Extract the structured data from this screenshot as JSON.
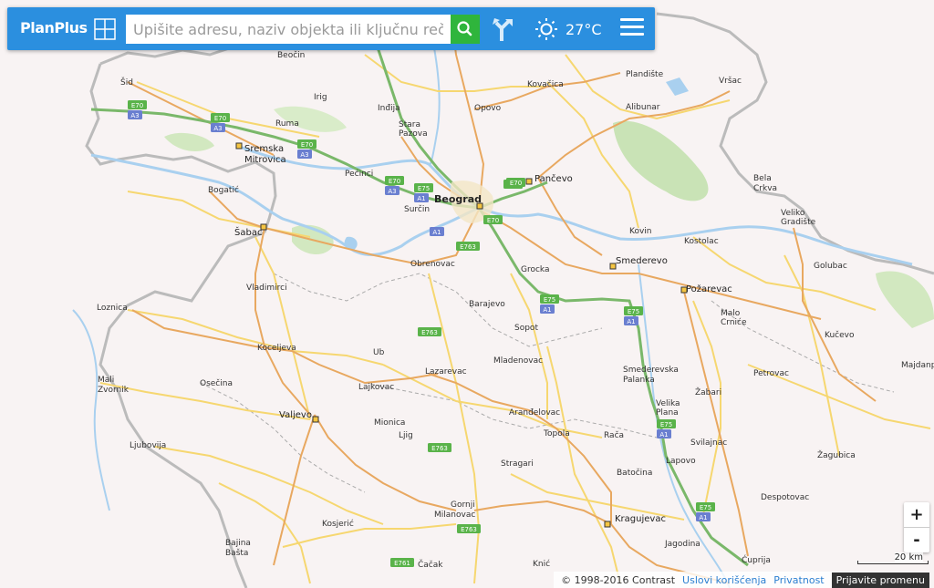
{
  "toolbar": {
    "logo": "PlanPlus",
    "search_placeholder": "Upišite adresu, naziv objekta ili ključnu reč",
    "temperature": "27°C",
    "icons": [
      "grid-icon",
      "search-icon",
      "route-icon",
      "sun-icon",
      "menu-icon"
    ]
  },
  "map": {
    "cities": [
      {
        "name": "Beočin",
        "style": "small"
      },
      {
        "name": "Šid",
        "style": "small"
      },
      {
        "name": "Irig",
        "style": "small"
      },
      {
        "name": "Inđija",
        "style": "small"
      },
      {
        "name": "Opovo",
        "style": "small"
      },
      {
        "name": "Kovačica",
        "style": "small"
      },
      {
        "name": "Plandište",
        "style": "small"
      },
      {
        "name": "Vršac",
        "style": "small"
      },
      {
        "name": "Alibunar",
        "style": "small"
      },
      {
        "name": "Ruma",
        "style": "small"
      },
      {
        "name": "Stara",
        "style": "small"
      },
      {
        "name": "Pazova",
        "style": "small"
      },
      {
        "name": "Sremska",
        "style": "mid"
      },
      {
        "name": "Mitrovica",
        "style": "mid"
      },
      {
        "name": "Pećinci",
        "style": "small"
      },
      {
        "name": "Pančevo",
        "style": "mid"
      },
      {
        "name": "Bela",
        "style": "small"
      },
      {
        "name": "Crkva",
        "style": "small"
      },
      {
        "name": "Bogatić",
        "style": "small"
      },
      {
        "name": "Beograd",
        "style": "big"
      },
      {
        "name": "Surčin",
        "style": "small"
      },
      {
        "name": "Veliko",
        "style": "small"
      },
      {
        "name": "Gradište",
        "style": "small"
      },
      {
        "name": "Šabac",
        "style": "mid"
      },
      {
        "name": "Kovin",
        "style": "small"
      },
      {
        "name": "Kostolac",
        "style": "small"
      },
      {
        "name": "Obrenovac",
        "style": "small"
      },
      {
        "name": "Grocka",
        "style": "small"
      },
      {
        "name": "Smederevo",
        "style": "mid"
      },
      {
        "name": "Golubac",
        "style": "small"
      },
      {
        "name": "Vladimirci",
        "style": "small"
      },
      {
        "name": "Požarevac",
        "style": "mid"
      },
      {
        "name": "Loznica",
        "style": "small"
      },
      {
        "name": "Barajevo",
        "style": "small"
      },
      {
        "name": "Malo",
        "style": "small"
      },
      {
        "name": "Crniće",
        "style": "small"
      },
      {
        "name": "Sopot",
        "style": "small"
      },
      {
        "name": "Kučevo",
        "style": "small"
      },
      {
        "name": "Koceljeva",
        "style": "small"
      },
      {
        "name": "Ub",
        "style": "small"
      },
      {
        "name": "Mladenovac",
        "style": "small"
      },
      {
        "name": "Majdanpek",
        "style": "small"
      },
      {
        "name": "Smederevska",
        "style": "small"
      },
      {
        "name": "Palanka",
        "style": "small"
      },
      {
        "name": "Lazarevac",
        "style": "small"
      },
      {
        "name": "Petrovac",
        "style": "small"
      },
      {
        "name": "Mali",
        "style": "small"
      },
      {
        "name": "Zvornik",
        "style": "small"
      },
      {
        "name": "Osečina",
        "style": "small"
      },
      {
        "name": "Lajkovac",
        "style": "small"
      },
      {
        "name": "Žabari",
        "style": "small"
      },
      {
        "name": "Velika",
        "style": "small"
      },
      {
        "name": "Plana",
        "style": "small"
      },
      {
        "name": "Valjevo",
        "style": "mid"
      },
      {
        "name": "Aranđelovac",
        "style": "small"
      },
      {
        "name": "Mionica",
        "style": "small"
      },
      {
        "name": "Topola",
        "style": "small"
      },
      {
        "name": "Rača",
        "style": "small"
      },
      {
        "name": "Svilajnac",
        "style": "small"
      },
      {
        "name": "Ljig",
        "style": "small"
      },
      {
        "name": "Ljubovija",
        "style": "small"
      },
      {
        "name": "Žagubica",
        "style": "small"
      },
      {
        "name": "Stragari",
        "style": "small"
      },
      {
        "name": "Lapovo",
        "style": "small"
      },
      {
        "name": "Batočina",
        "style": "small"
      },
      {
        "name": "Despotovac",
        "style": "small"
      },
      {
        "name": "Gornji",
        "style": "small"
      },
      {
        "name": "Milanovac",
        "style": "small"
      },
      {
        "name": "Kragujevac",
        "style": "mid"
      },
      {
        "name": "Kosjerić",
        "style": "small"
      },
      {
        "name": "Jagodina",
        "style": "small"
      },
      {
        "name": "Bajina",
        "style": "small"
      },
      {
        "name": "Bašta",
        "style": "small"
      },
      {
        "name": "Ćuprija",
        "style": "small"
      },
      {
        "name": "Čačak",
        "style": "small"
      },
      {
        "name": "Knić",
        "style": "small"
      }
    ],
    "road_shields": [
      {
        "label": "E70",
        "color": "#5ab34a"
      },
      {
        "label": "A3",
        "color": "#6a7fd0"
      },
      {
        "label": "E70",
        "color": "#5ab34a"
      },
      {
        "label": "A3",
        "color": "#6a7fd0"
      },
      {
        "label": "E70",
        "color": "#5ab34a"
      },
      {
        "label": "A3",
        "color": "#6a7fd0"
      },
      {
        "label": "E70",
        "color": "#5ab34a"
      },
      {
        "label": "A3",
        "color": "#6a7fd0"
      },
      {
        "label": "E75",
        "color": "#5ab34a"
      },
      {
        "label": "A1",
        "color": "#6a7fd0"
      },
      {
        "label": "E70",
        "color": "#5ab34a"
      },
      {
        "label": "E70",
        "color": "#5ab34a"
      },
      {
        "label": "E70",
        "color": "#5ab34a"
      },
      {
        "label": "A1",
        "color": "#6a7fd0"
      },
      {
        "label": "E763",
        "color": "#5ab34a"
      },
      {
        "label": "E75",
        "color": "#5ab34a"
      },
      {
        "label": "A1",
        "color": "#6a7fd0"
      },
      {
        "label": "E75",
        "color": "#5ab34a"
      },
      {
        "label": "A1",
        "color": "#6a7fd0"
      },
      {
        "label": "E763",
        "color": "#5ab34a"
      },
      {
        "label": "E75",
        "color": "#5ab34a"
      },
      {
        "label": "A1",
        "color": "#6a7fd0"
      },
      {
        "label": "E763",
        "color": "#5ab34a"
      },
      {
        "label": "E75",
        "color": "#5ab34a"
      },
      {
        "label": "A1",
        "color": "#6a7fd0"
      },
      {
        "label": "E763",
        "color": "#5ab34a"
      },
      {
        "label": "E761",
        "color": "#5ab34a"
      }
    ]
  },
  "controls": {
    "zoom_in": "+",
    "zoom_out": "-",
    "scale": "20 km"
  },
  "footer": {
    "copyright": "© 1998-2016 Contrast",
    "terms": "Uslovi korišćenja",
    "privacy": "Privatnost",
    "report": "Prijavite promenu"
  }
}
